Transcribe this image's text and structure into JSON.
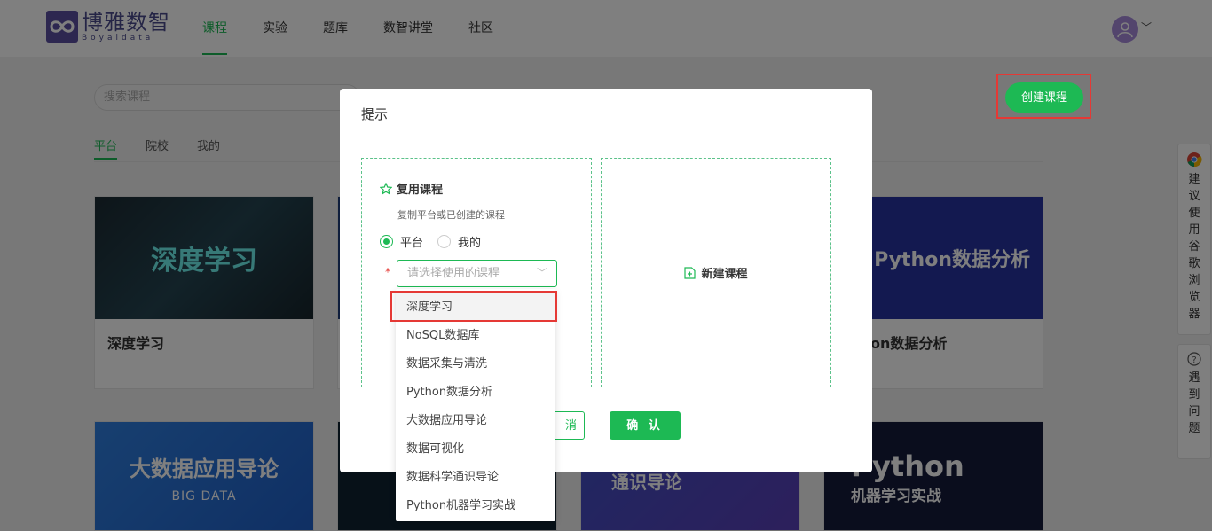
{
  "header": {
    "logo_title": "博雅数智",
    "logo_sub": "Boyaidata",
    "nav": [
      {
        "label": "课程",
        "active": true
      },
      {
        "label": "实验",
        "active": false
      },
      {
        "label": "题库",
        "active": false
      },
      {
        "label": "数智讲堂",
        "active": false
      },
      {
        "label": "社区",
        "active": false
      }
    ]
  },
  "search": {
    "placeholder": "搜索课程"
  },
  "tabs": [
    "平台",
    "院校",
    "我的"
  ],
  "create_button": "创建课程",
  "cards": [
    {
      "img_text": "深度学习",
      "title": "深度学习"
    },
    {
      "img_text": "Python数据分析",
      "title": "on数据分析"
    },
    {
      "img_text": "大数据应用导论",
      "img_sub": "BIG DATA"
    },
    {
      "img_text": "通识导论"
    },
    {
      "img_text": "Python",
      "img_sub": "机器学习实战"
    }
  ],
  "side_tools": {
    "browser_tip": "建议使用谷歌浏览器",
    "help": "遇到问题"
  },
  "modal": {
    "title": "提示",
    "reuse_title": "复用课程",
    "reuse_desc": "复制平台或已创建的课程",
    "radio_platform": "平台",
    "radio_mine": "我的",
    "required_mark": "*",
    "select_placeholder": "请选择使用的课程",
    "new_course": "新建课程",
    "cancel_label": "消",
    "ok_label": "确 认"
  },
  "dropdown": {
    "options": [
      "深度学习",
      "NoSQL数据库",
      "数据采集与清洗",
      "Python数据分析",
      "大数据应用导论",
      "数据可视化",
      "数据科学通识导论",
      "Python机器学习实战"
    ],
    "selected": "深度学习"
  },
  "colors": {
    "accent": "#1db954",
    "highlight": "#e53935",
    "brand": "#4a4a8c"
  }
}
